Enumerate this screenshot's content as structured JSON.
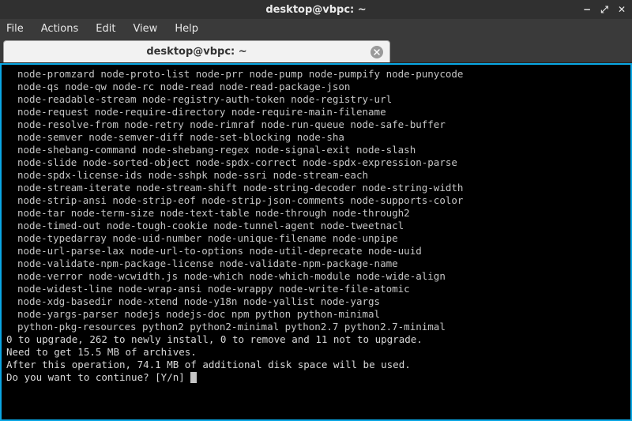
{
  "window": {
    "title": "desktop@vbpc: ~",
    "controls": {
      "min": "−",
      "max": "⤢",
      "close": "✕"
    }
  },
  "menu": {
    "file": "File",
    "actions": "Actions",
    "edit": "Edit",
    "view": "View",
    "help": "Help"
  },
  "tab": {
    "label": "desktop@vbpc: ~"
  },
  "pkg_lines": [
    "node-promzard node-proto-list node-prr node-pump node-pumpify node-punycode",
    "node-qs node-qw node-rc node-read node-read-package-json",
    "node-readable-stream node-registry-auth-token node-registry-url",
    "node-request node-require-directory node-require-main-filename",
    "node-resolve-from node-retry node-rimraf node-run-queue node-safe-buffer",
    "node-semver node-semver-diff node-set-blocking node-sha",
    "node-shebang-command node-shebang-regex node-signal-exit node-slash",
    "node-slide node-sorted-object node-spdx-correct node-spdx-expression-parse",
    "node-spdx-license-ids node-sshpk node-ssri node-stream-each",
    "node-stream-iterate node-stream-shift node-string-decoder node-string-width",
    "node-strip-ansi node-strip-eof node-strip-json-comments node-supports-color",
    "node-tar node-term-size node-text-table node-through node-through2",
    "node-timed-out node-tough-cookie node-tunnel-agent node-tweetnacl",
    "node-typedarray node-uid-number node-unique-filename node-unpipe",
    "node-url-parse-lax node-url-to-options node-util-deprecate node-uuid",
    "node-validate-npm-package-license node-validate-npm-package-name",
    "node-verror node-wcwidth.js node-which node-which-module node-wide-align",
    "node-widest-line node-wrap-ansi node-wrappy node-write-file-atomic",
    "node-xdg-basedir node-xtend node-y18n node-yallist node-yargs",
    "node-yargs-parser nodejs nodejs-doc npm python python-minimal",
    "python-pkg-resources python2 python2-minimal python2.7 python2.7-minimal"
  ],
  "summary": {
    "upgrade": "0 to upgrade, 262 to newly install, 0 to remove and 11 not to upgrade.",
    "archives": "Need to get 15.5 MB of archives.",
    "diskspace": "After this operation, 74.1 MB of additional disk space will be used.",
    "prompt": "Do you want to continue? [Y/n] "
  }
}
